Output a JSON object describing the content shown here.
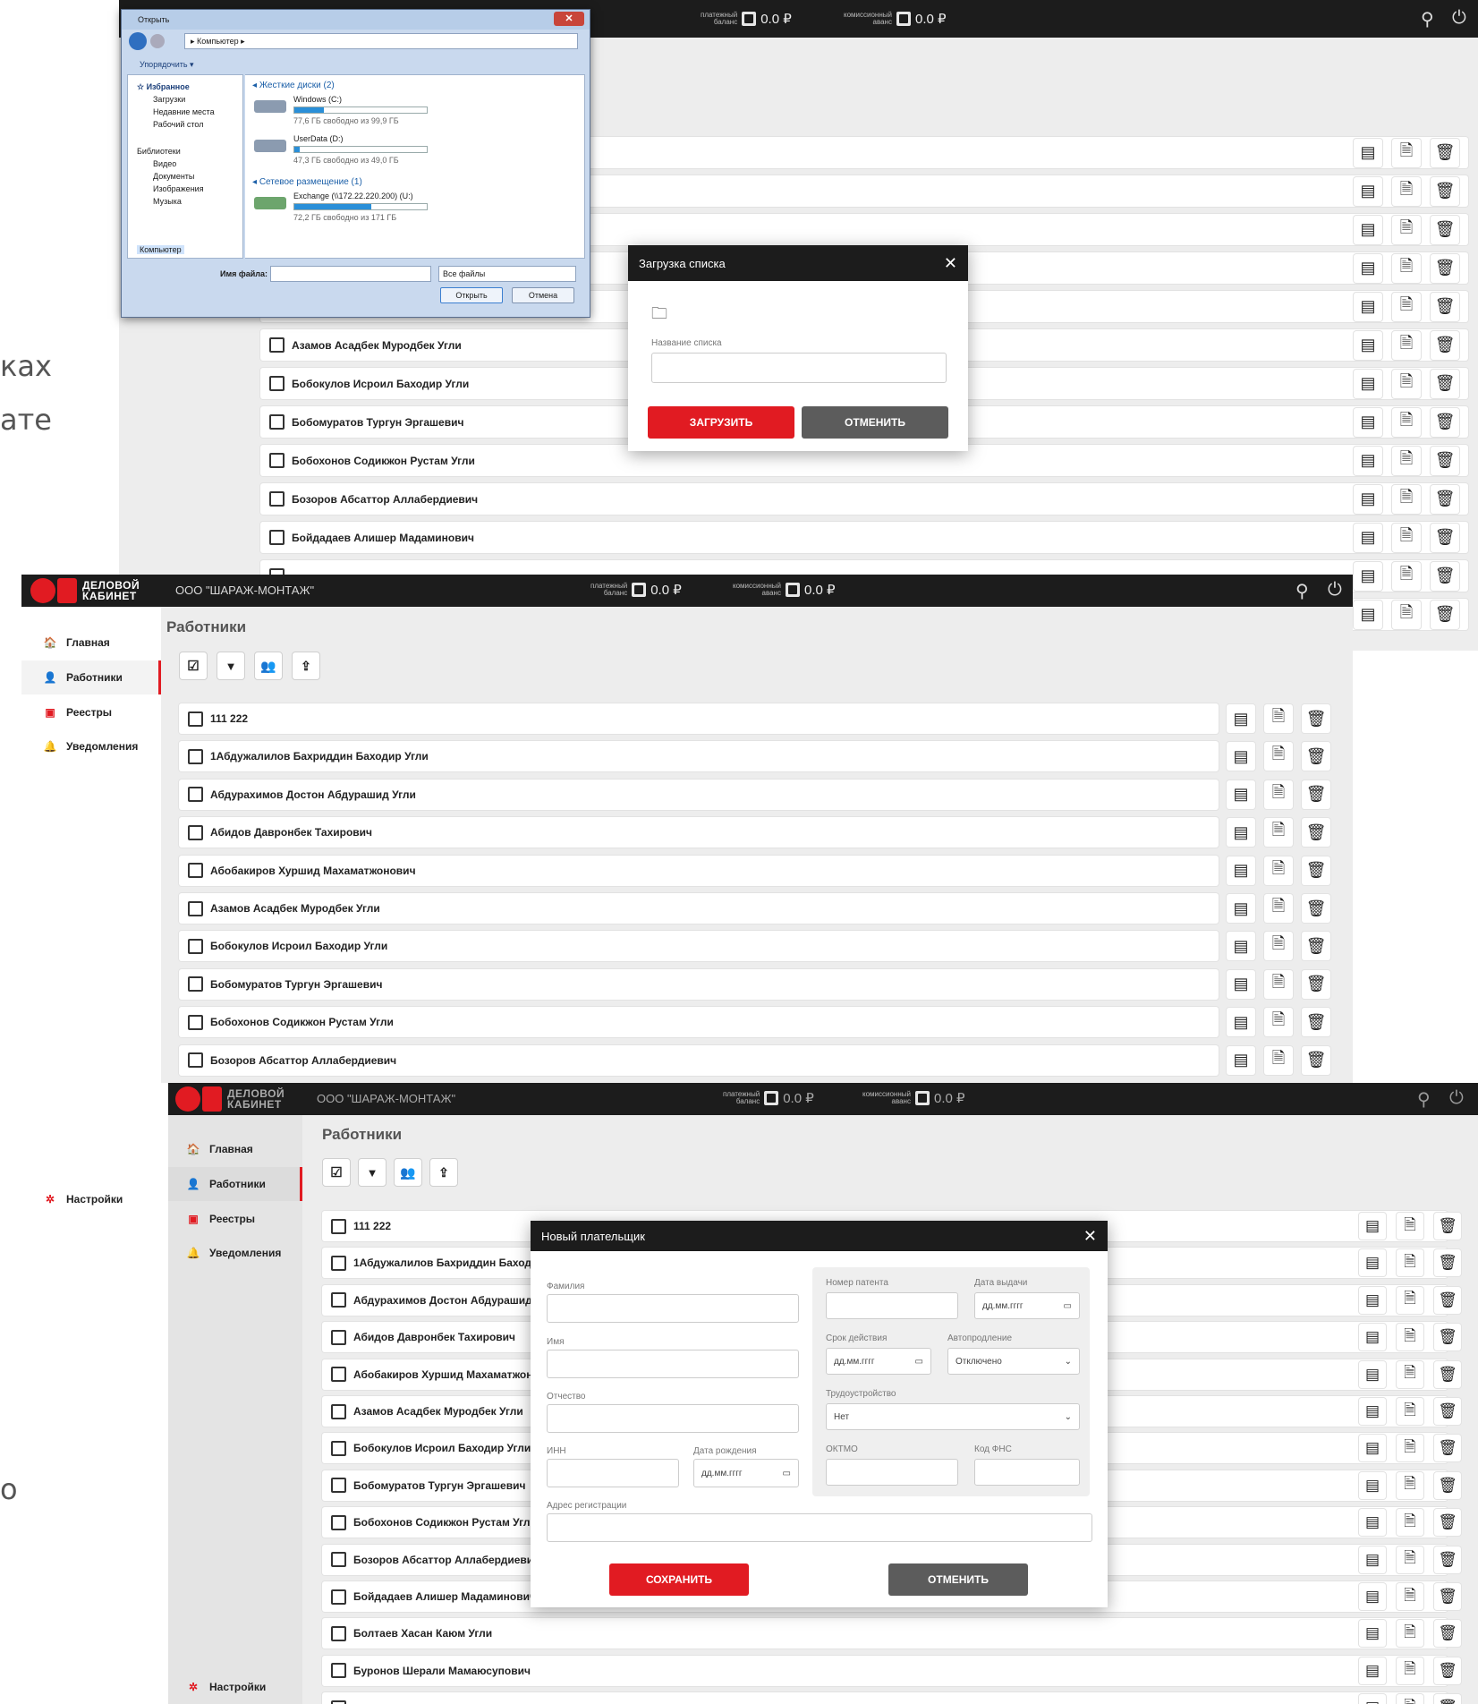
{
  "left_fragments": [
    "ках",
    "ате",
    "о"
  ],
  "brand": {
    "line1": "ДЕЛОВОЙ",
    "line2": "КАБИНЕТ"
  },
  "company": "ООО \"ШАРАЖ-МОНТАЖ\"",
  "balances": [
    {
      "caption1": "платежный",
      "caption2": "баланс",
      "value": "0.0 ₽"
    },
    {
      "caption1": "комиссионный",
      "caption2": "аванс",
      "value": "0.0 ₽"
    }
  ],
  "icons": {
    "search": "search-icon",
    "power": "power-icon",
    "home": "home-icon",
    "user": "user-icon",
    "registry": "registry-icon",
    "bell": "bell-icon",
    "gear": "gear-icon",
    "receipt": "receipt-icon",
    "document": "document-icon",
    "trash": "trash-icon",
    "folder": "folder-icon"
  },
  "colors": {
    "accent": "#e11b22",
    "topbar": "#1c1c1c",
    "secondary_button": "#5c5c5c"
  },
  "nav": [
    {
      "label": "Главная",
      "glyph": "🏠"
    },
    {
      "label": "Работники",
      "glyph": "👤"
    },
    {
      "label": "Реестры",
      "glyph": "▣"
    },
    {
      "label": "Уведомления",
      "glyph": "🔔"
    }
  ],
  "settings_label": "Настройки",
  "page_title": "Работники",
  "toolbar": [
    "☑",
    "▼",
    "👥",
    "⇪"
  ],
  "workers_panel2": [
    "111 222",
    "1Абдужалилов Бахриддин Баходир Угли",
    "Абдурахимов Достон Абдурашид Угли",
    "Абидов Давронбек Тахирович",
    "Абобакиров Хуршид Махаматжонович",
    "Азамов Асадбек Муродбек Угли",
    "Бобокулов Исроил Баходир Угли",
    "Бобомуратов Тургун Эргашевич",
    "Бобохонов Содикжон Рустам Угли",
    "Бозоров Абсаттор Аллабердиевич"
  ],
  "workers_panel1": [
    "Азамов Асадбек Муродбек Угли",
    "Бобокулов Исроил Баходир Угли",
    "Бобомуратов Тургун Эргашевич",
    "Бобохонов Содикжон Рустам Угли",
    "Бозоров Абсаттор Аллабердиевич",
    "Бойдадаев Алишер Мадаминович"
  ],
  "workers_panel3": [
    "111 222",
    "1Абдужалилов Бахриддин Баходир Угли",
    "Абдурахимов Достон Абдурашид Угли",
    "Абидов Давронбек Тахирович",
    "Абобакиров Хуршид Махаматжонович",
    "Азамов Асадбек Муродбек Угли",
    "Бобокулов Исроил Баходир Угли",
    "Бобомуратов Тургун Эргашевич",
    "Бобохонов Содикжон Рустам Угли",
    "Бозоров Абсаттор Аллабердиевич",
    "Бойдадаев Алишер Мадаминович",
    "Болтаев Хасан Каюм Угли",
    "Буронов Шерали Мамаюсупович"
  ],
  "upload_modal": {
    "title": "Загрузка списка",
    "field_label": "Название списка",
    "field_value": "",
    "upload_button": "ЗАГРУЗИТЬ",
    "cancel_button": "ОТМЕНИТЬ"
  },
  "payer_modal": {
    "title": "Новый плательщик",
    "surname_label": "Фамилия",
    "name_label": "Имя",
    "patronymic_label": "Отчество",
    "inn_label": "ИНН",
    "birthdate_label": "Дата рождения",
    "date_placeholder": "дд.мм.гггг",
    "address_label": "Адрес регистрации",
    "patent_label": "Номер патента",
    "issue_date_label": "Дата выдачи",
    "validity_label": "Срок действия",
    "autorenew_label": "Автопродление",
    "autorenew_value": "Отключено",
    "employment_label": "Трудоустройство",
    "employment_value": "Нет",
    "oktmo_label": "ОКТМО",
    "fns_label": "Код ФНС",
    "save_button": "СОХРАНИТЬ",
    "cancel_button": "ОТМЕНИТЬ"
  },
  "file_dialog": {
    "title": "Открыть",
    "address": "▸ Компьютер ▸",
    "organize": "Упорядочить ▾",
    "favorites": "Избранное",
    "fav_items": [
      "Загрузки",
      "Недавние места",
      "Рабочий стол"
    ],
    "libraries": "Библиотеки",
    "lib_items": [
      "Видео",
      "Документы",
      "Изображения",
      "Музыка"
    ],
    "computer": "Компьютер",
    "hdd_group": "Жесткие диски (2)",
    "drives": [
      {
        "name": "Windows (C:)",
        "free": "77,6 ГБ свободно из 99,9 ГБ",
        "used_fraction": 0.22
      },
      {
        "name": "UserData (D:)",
        "free": "47,3 ГБ свободно из 49,0 ГБ",
        "used_fraction": 0.04
      }
    ],
    "net_group": "Сетевое размещение (1)",
    "net_drive": {
      "name": "Exchange (\\\\172.22.220.200) (U:)",
      "free": "72,2 ГБ свободно из 171 ГБ",
      "used_fraction": 0.58
    },
    "filename_label": "Имя файла:",
    "filter": "Все файлы",
    "open_button": "Открыть",
    "cancel_button": "Отмена"
  }
}
